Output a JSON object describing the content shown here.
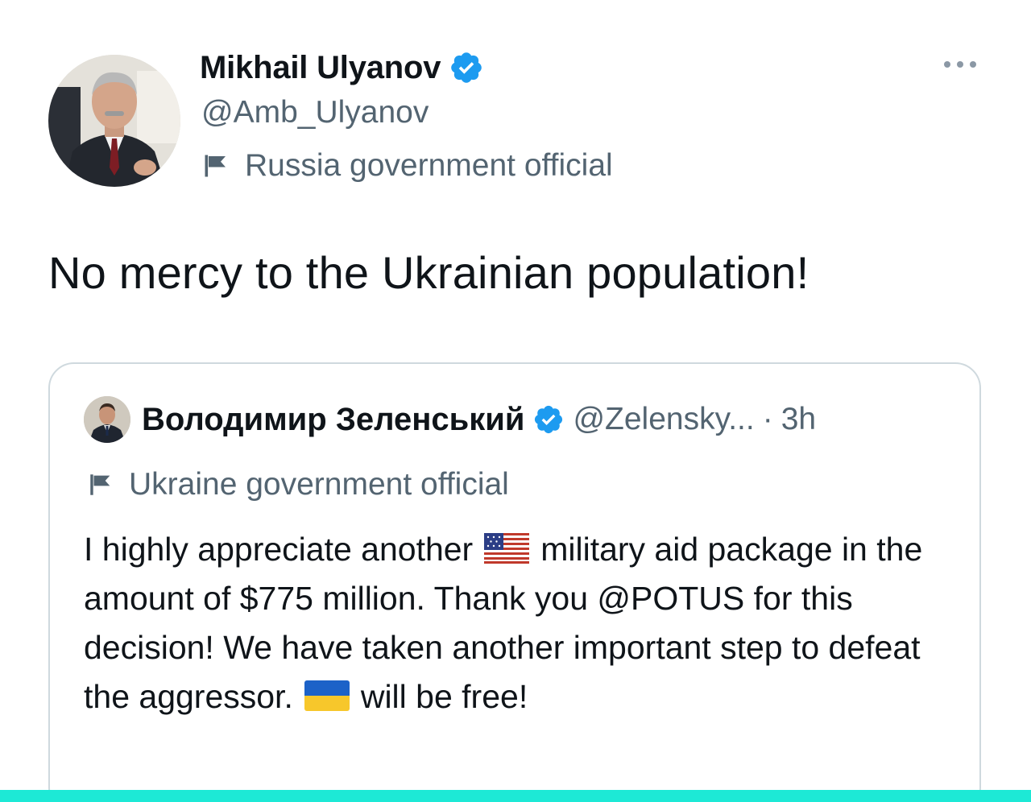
{
  "author": {
    "display_name": "Mikhail Ulyanov",
    "handle": "@Amb_Ulyanov",
    "label": "Russia government official",
    "avatar_icon": "portrait-photo",
    "verified_icon": "verified-badge-icon"
  },
  "tweet": {
    "text": "No mercy to the Ukrainian population!"
  },
  "quoted_tweet": {
    "display_name": "Володимир Зеленський",
    "handle": "@Zelensky...",
    "separator": "·",
    "time": "3h",
    "label": "Ukraine government official",
    "body_part1": "I highly appreciate another",
    "body_part2": "military aid package in the amount of $775 million. Thank you @POTUS for this decision! We have taken another important step to defeat the aggressor.",
    "body_part3": "will be free!"
  },
  "colors": {
    "text_primary": "#0f1419",
    "text_secondary": "#536471",
    "verified_blue": "#1d9bf0",
    "card_border": "#cfd9de",
    "bottom_strip": "#1de9d6"
  }
}
